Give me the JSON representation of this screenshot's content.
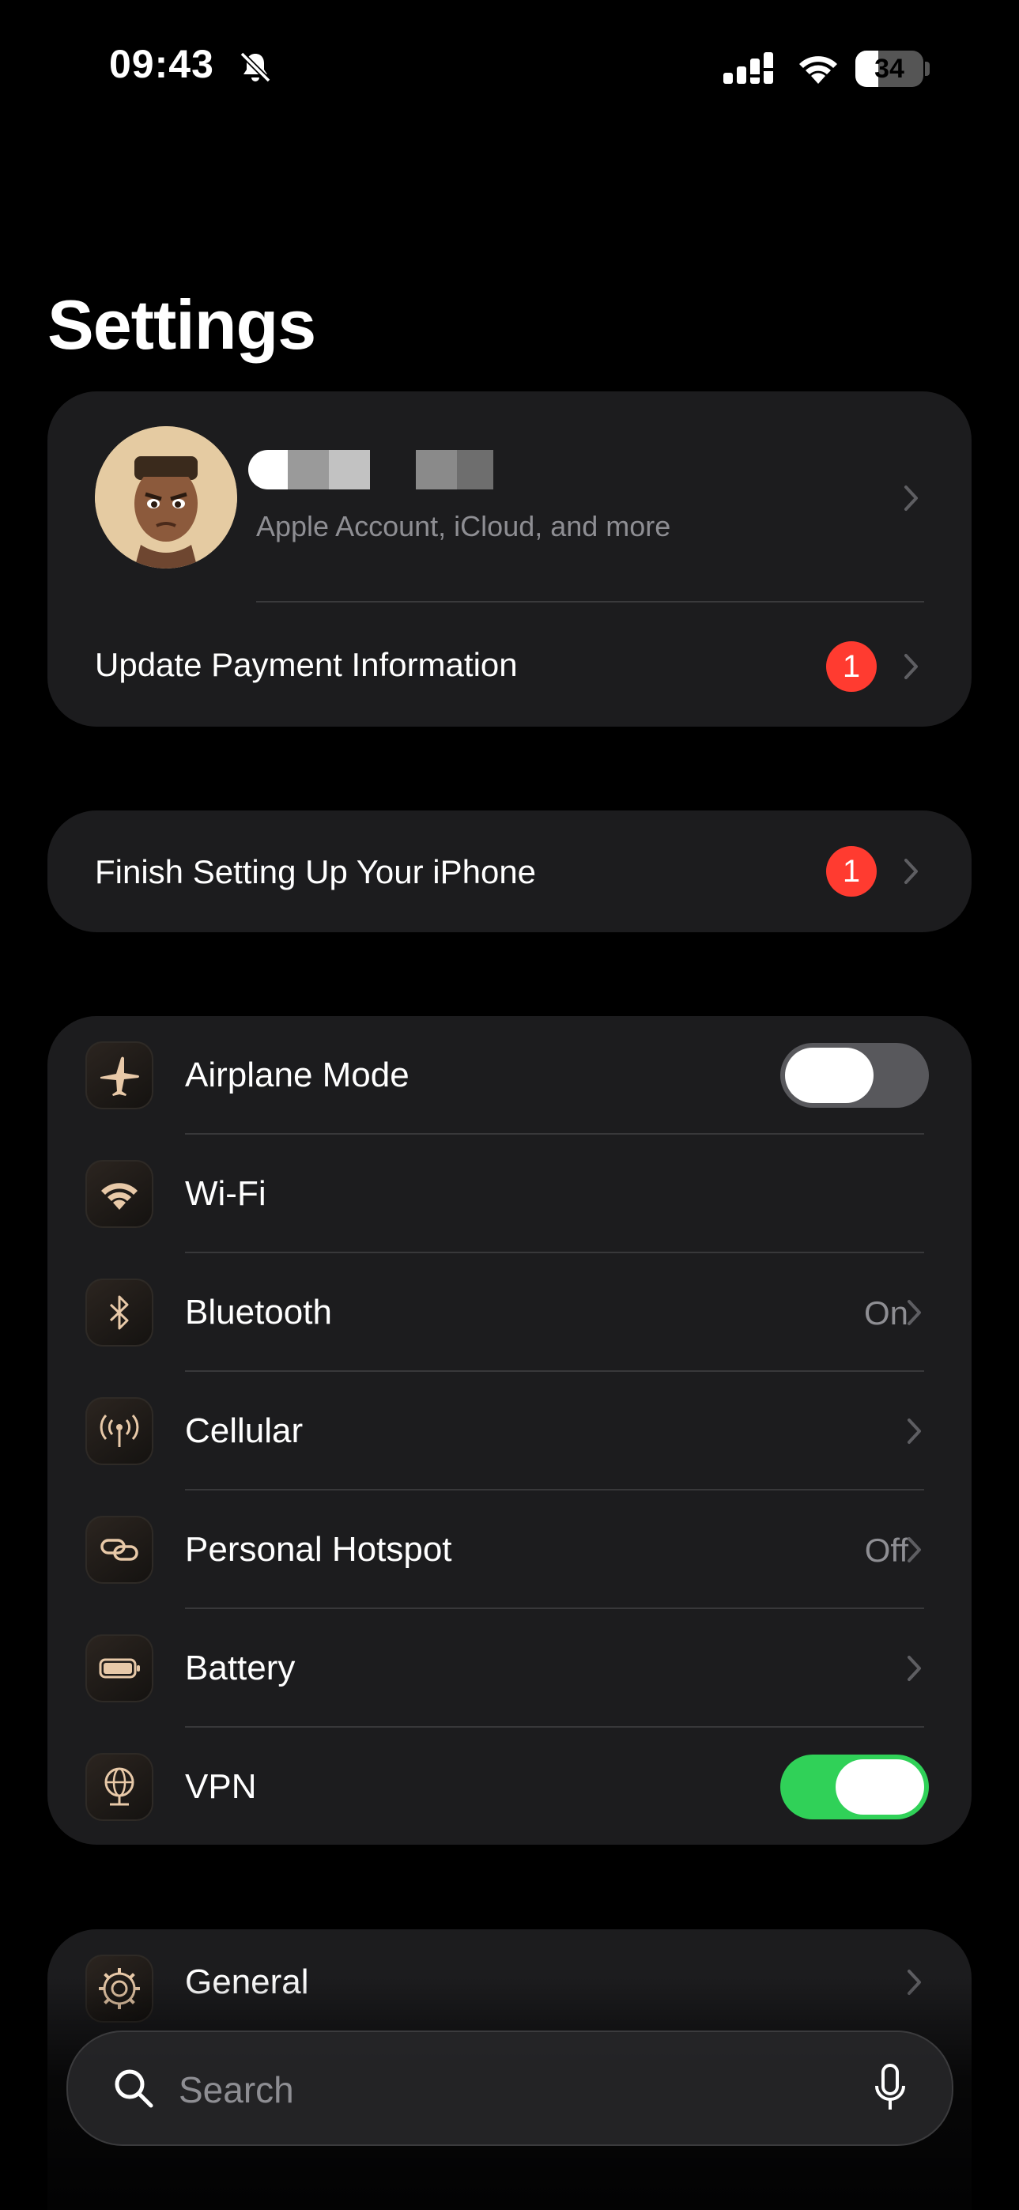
{
  "status_bar": {
    "time": "09:43",
    "battery_level": "34",
    "battery_fraction": 0.34
  },
  "page_title": "Settings",
  "profile": {
    "subtitle": "Apple Account, iCloud, and more",
    "name_redacted": true,
    "payment_row": {
      "label": "Update Payment Information",
      "badge": "1"
    }
  },
  "setup": {
    "label": "Finish Setting Up Your iPhone",
    "badge": "1"
  },
  "connectivity": [
    {
      "label": "Airplane Mode",
      "control": "toggle",
      "on": false,
      "icon": "airplane-icon"
    },
    {
      "label": "Wi-Fi",
      "control": "none",
      "icon": "wifi-icon"
    },
    {
      "label": "Bluetooth",
      "value": "On",
      "control": "chevron",
      "icon": "bluetooth-icon"
    },
    {
      "label": "Cellular",
      "control": "chevron",
      "icon": "cellular-antenna-icon"
    },
    {
      "label": "Personal Hotspot",
      "value": "Off",
      "control": "chevron",
      "icon": "hotspot-link-icon"
    },
    {
      "label": "Battery",
      "control": "chevron",
      "icon": "battery-icon"
    },
    {
      "label": "VPN",
      "control": "toggle",
      "on": true,
      "icon": "vpn-globe-icon"
    }
  ],
  "general": {
    "label": "General",
    "icon": "gear-icon"
  },
  "search": {
    "placeholder": "Search"
  },
  "colors": {
    "background": "#000000",
    "card": "#1c1c1e",
    "badge": "#ff3b30",
    "toggle_on": "#30d158",
    "toggle_off": "#58585c",
    "icon_tint": "#e8c9a8",
    "secondary_text": "#8e8e93"
  }
}
